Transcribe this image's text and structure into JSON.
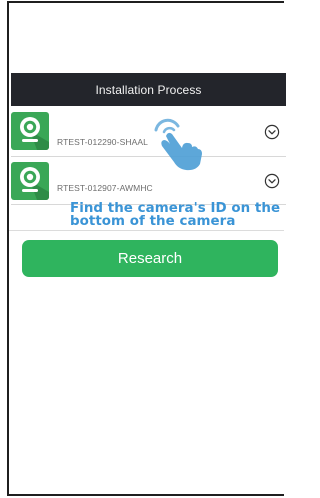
{
  "header": {
    "title": "Installation Process"
  },
  "devices": [
    {
      "id": "RTEST-012290-SHAAL",
      "icon": "camera-icon",
      "expand_icon": "chevron-down-circle-icon"
    },
    {
      "id": "RTEST-012907-AWMHC",
      "icon": "camera-icon",
      "expand_icon": "chevron-down-circle-icon"
    }
  ],
  "hint": {
    "text": "Find the camera's ID on the bottom of the camera",
    "color": "#3a94d6"
  },
  "research_button": {
    "label": "Research",
    "color": "#2fb45e"
  },
  "colors": {
    "header_bg": "#23252b",
    "camera_tile": "#3aa757",
    "hand_pointer": "#4f9fd6"
  }
}
